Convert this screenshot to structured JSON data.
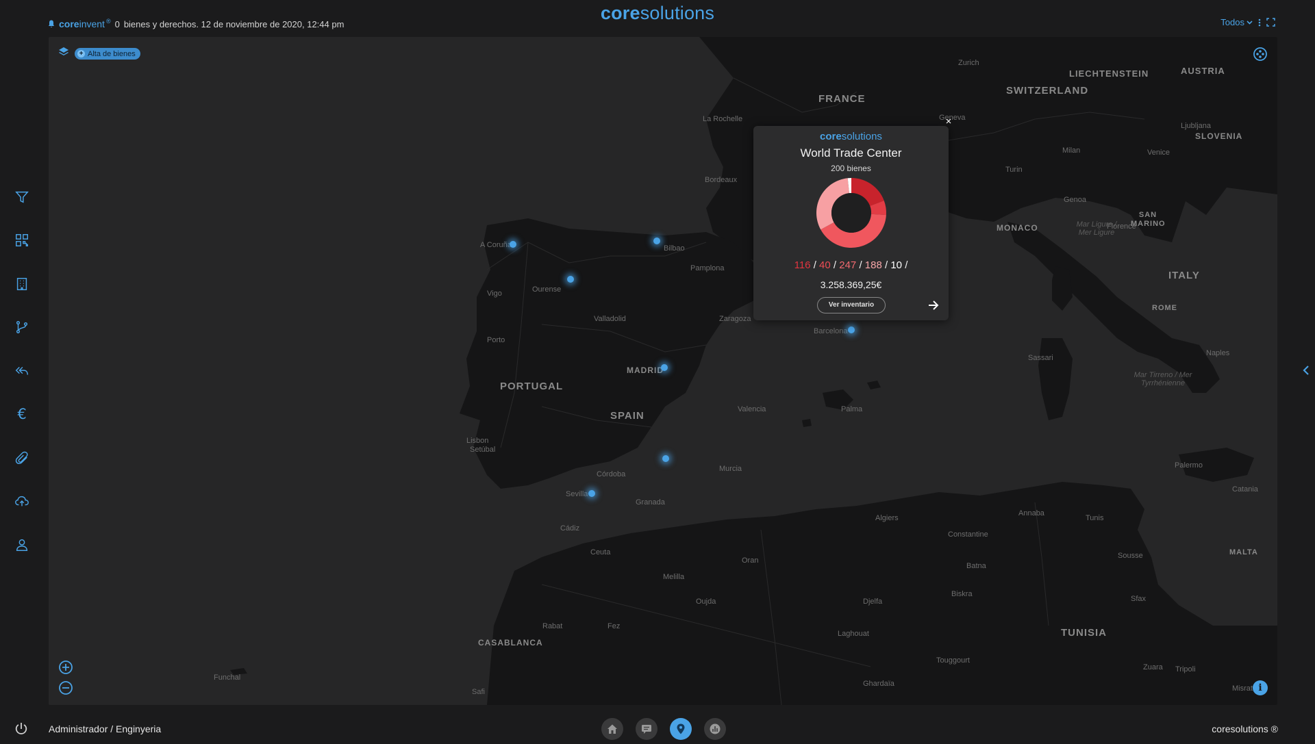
{
  "header": {
    "brand_bold": "core",
    "brand_light": "solutions",
    "app_bold": "core",
    "app_light": "invent",
    "app_reg": "®",
    "count": "0",
    "status_text": "bienes y derechos. 12 de noviembre de 2020, 12:44 pm",
    "filter_label": "Todos"
  },
  "sidebar": {
    "items": [
      {
        "icon": "filter-icon"
      },
      {
        "icon": "qr-code-icon"
      },
      {
        "icon": "building-icon"
      },
      {
        "icon": "branch-icon"
      },
      {
        "icon": "reply-all-icon"
      },
      {
        "icon": "euro-icon",
        "glyph": "€"
      },
      {
        "icon": "attachment-icon"
      },
      {
        "icon": "cloud-upload-icon"
      },
      {
        "icon": "user-icon"
      }
    ]
  },
  "map": {
    "chip_label": "Alta de bienes",
    "countries": [
      "FRANCE",
      "SWITZERLAND",
      "LIECHTENSTEIN",
      "AUSTRIA",
      "SLOVENIA",
      "ITALY",
      "SAN MARINO",
      "MONACO",
      "PORTUGAL",
      "SPAIN",
      "TUNISIA",
      "MALTA"
    ],
    "cities": [
      "Zurich",
      "Geneva",
      "Ljubljana",
      "Milan",
      "Venice",
      "Turin",
      "Genoa",
      "Florence",
      "La Rochelle",
      "Bordeaux",
      "A Coruña",
      "Bilbao",
      "Pamplona",
      "Vigo",
      "Ourense",
      "Valladolid",
      "Zaragoza",
      "Barcelona",
      "Porto",
      "MADRID",
      "Valencia",
      "Palma",
      "Sassari",
      "Naples",
      "ROME",
      "Lisbon",
      "Setúbal",
      "Córdoba",
      "Murcia",
      "Sevilla",
      "Granada",
      "Cádiz",
      "Ceuta",
      "Algiers",
      "Annaba",
      "Tunis",
      "Constantine",
      "Palermo",
      "Catania",
      "Sousse",
      "Oran",
      "Batna",
      "Melilla",
      "Oujda",
      "Biskra",
      "Sfax",
      "Rabat",
      "Fez",
      "Djelfa",
      "CASABLANCA",
      "Laghouat",
      "Touggourt",
      "Zuara",
      "Tripoli",
      "Ghardaïa",
      "Funchal",
      "Safi",
      "Misrata"
    ],
    "seas": [
      "Mar Ligure / Mer Ligure",
      "Mar Tirreno / Mer Tyrrhénienne"
    ]
  },
  "popup": {
    "brand_bold": "core",
    "brand_light": "solutions",
    "title": "World Trade Center",
    "count_label": "200 bienes",
    "stats": [
      "116",
      "40",
      "247",
      "188",
      "10"
    ],
    "total": "3.258.369,25€",
    "button_label": "Ver inventario",
    "close_glyph": "×",
    "donut": [
      {
        "value": 116,
        "color": "#c8232c"
      },
      {
        "value": 40,
        "color": "#e23c45"
      },
      {
        "value": 247,
        "color": "#f0575e"
      },
      {
        "value": 188,
        "color": "#f7a0a3"
      },
      {
        "value": 10,
        "color": "#ffffff"
      }
    ]
  },
  "footer": {
    "user": "Administrador / Enginyeria",
    "copyright": "coresolutions ®"
  },
  "colors": {
    "accent": "#4aa3e6",
    "background": "#1b1b1c",
    "map": "#262627",
    "land": "#151516"
  }
}
